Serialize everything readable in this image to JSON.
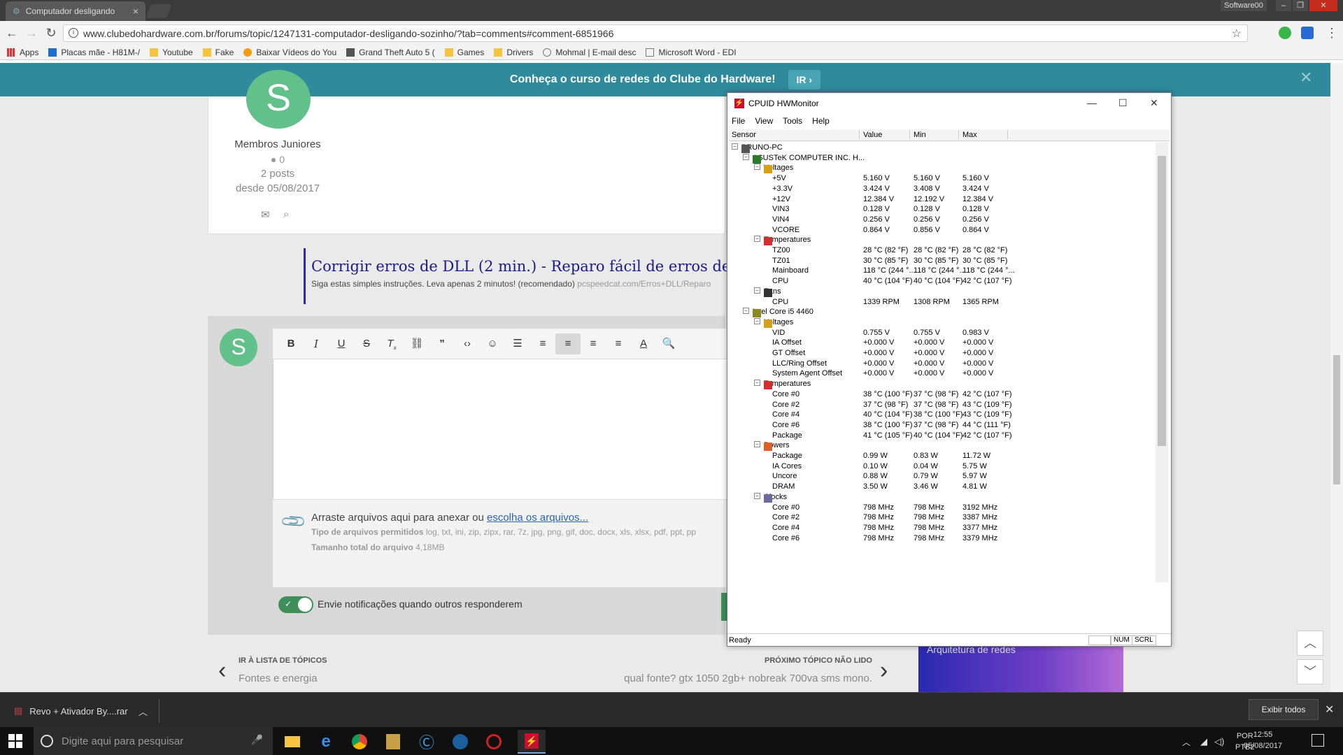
{
  "browser": {
    "tab_title": "Computador desligando",
    "profile": "Software00",
    "url": "www.clubedohardware.com.br/forums/topic/1247131-computador-desligando-sozinho/?tab=comments#comment-6851966",
    "bookmarks": [
      "Apps",
      "Placas mãe - H81M-/",
      "Youtube",
      "Fake",
      "Baixar Vídeos do You",
      "Grand Theft Auto 5 (",
      "Games",
      "Drivers",
      "Mohmal | E-mail desc",
      "Microsoft Word - EDI"
    ]
  },
  "banner": {
    "text": "Conheça o curso de redes do Clube do Hardware!",
    "button": "IR ›"
  },
  "post": {
    "avatar_letter": "S",
    "rank": "Membros Juniores",
    "reputation": "0",
    "posts": "2 posts",
    "since": "desde 05/08/2017"
  },
  "ad": {
    "title": "Corrigir erros de DLL (2 min.) - Reparo fácil de erros de DLL",
    "subtitle": "Siga estas simples instruções. Leva apenas 2 minutos! (recomendado)",
    "url": "pcspeedcat.com/Erros+DLL/Reparo"
  },
  "reply": {
    "avatar_letter": "S",
    "attach_text": "Arraste arquivos aqui para anexar ou",
    "attach_link": "escolha os arquivos...",
    "types_label": "Tipo de arquivos permitidos",
    "types": "log, txt, ini, zip, zipx, rar, 7z, jpg, png, gif, doc, docx, xls, xlsx, pdf, ppt, pp",
    "size_label": "Tamanho total do arquivo",
    "size": "4,18MB",
    "notify": "Envie notificações quando outros responderem"
  },
  "nav": {
    "back_label": "IR À LISTA DE TÓPICOS",
    "back_value": "Fontes e energia",
    "next_label": "PRÓXIMO TÓPICO NÃO LIDO",
    "next_value": "qual fonte? gtx 1050 2gb+ nobreak 700va sms mono.",
    "ad_caption": "Arquitetura de redes"
  },
  "hwmonitor": {
    "title": "CPUID HWMonitor",
    "menu": [
      "File",
      "View",
      "Tools",
      "Help"
    ],
    "columns": [
      "Sensor",
      "Value",
      "Min",
      "Max"
    ],
    "status": "Ready",
    "status_num": "NUM",
    "status_scrl": "SCRL",
    "rows": [
      {
        "level": 0,
        "icon": "pc",
        "name": "BRUNO-PC",
        "toggle": "-"
      },
      {
        "level": 1,
        "icon": "board",
        "name": "ASUSTeK COMPUTER INC. H...",
        "toggle": "-"
      },
      {
        "level": 2,
        "icon": "volt",
        "name": "Voltages",
        "toggle": "-"
      },
      {
        "level": 3,
        "name": "+5V",
        "value": "5.160 V",
        "min": "5.160 V",
        "max": "5.160 V"
      },
      {
        "level": 3,
        "name": "+3.3V",
        "value": "3.424 V",
        "min": "3.408 V",
        "max": "3.424 V"
      },
      {
        "level": 3,
        "name": "+12V",
        "value": "12.384 V",
        "min": "12.192 V",
        "max": "12.384 V"
      },
      {
        "level": 3,
        "name": "VIN3",
        "value": "0.128 V",
        "min": "0.128 V",
        "max": "0.128 V"
      },
      {
        "level": 3,
        "name": "VIN4",
        "value": "0.256 V",
        "min": "0.256 V",
        "max": "0.256 V"
      },
      {
        "level": 3,
        "name": "VCORE",
        "value": "0.864 V",
        "min": "0.856 V",
        "max": "0.864 V"
      },
      {
        "level": 2,
        "icon": "temp",
        "name": "Temperatures",
        "toggle": "-"
      },
      {
        "level": 3,
        "name": "TZ00",
        "value": "28 °C  (82 °F)",
        "min": "28 °C  (82 °F)",
        "max": "28 °C  (82 °F)"
      },
      {
        "level": 3,
        "name": "TZ01",
        "value": "30 °C  (85 °F)",
        "min": "30 °C  (85 °F)",
        "max": "30 °C  (85 °F)"
      },
      {
        "level": 3,
        "name": "Mainboard",
        "value": "118 °C  (244 °...",
        "min": "118 °C  (244 °...",
        "max": "118 °C  (244 °..."
      },
      {
        "level": 3,
        "name": "CPU",
        "value": "40 °C  (104 °F)",
        "min": "40 °C  (104 °F)",
        "max": "42 °C  (107 °F)"
      },
      {
        "level": 2,
        "icon": "fan",
        "name": "Fans",
        "toggle": "-"
      },
      {
        "level": 3,
        "name": "CPU",
        "value": "1339 RPM",
        "min": "1308 RPM",
        "max": "1365 RPM"
      },
      {
        "level": 1,
        "icon": "cpu",
        "name": "Intel Core i5 4460",
        "toggle": "-"
      },
      {
        "level": 2,
        "icon": "volt",
        "name": "Voltages",
        "toggle": "-"
      },
      {
        "level": 3,
        "name": "VID",
        "value": "0.755 V",
        "min": "0.755 V",
        "max": "0.983 V"
      },
      {
        "level": 3,
        "name": "IA Offset",
        "value": "+0.000 V",
        "min": "+0.000 V",
        "max": "+0.000 V"
      },
      {
        "level": 3,
        "name": "GT Offset",
        "value": "+0.000 V",
        "min": "+0.000 V",
        "max": "+0.000 V"
      },
      {
        "level": 3,
        "name": "LLC/Ring Offset",
        "value": "+0.000 V",
        "min": "+0.000 V",
        "max": "+0.000 V"
      },
      {
        "level": 3,
        "name": "System Agent Offset",
        "value": "+0.000 V",
        "min": "+0.000 V",
        "max": "+0.000 V"
      },
      {
        "level": 2,
        "icon": "temp",
        "name": "Temperatures",
        "toggle": "-"
      },
      {
        "level": 3,
        "name": "Core #0",
        "value": "38 °C  (100 °F)",
        "min": "37 °C  (98 °F)",
        "max": "42 °C  (107 °F)"
      },
      {
        "level": 3,
        "name": "Core #2",
        "value": "37 °C  (98 °F)",
        "min": "37 °C  (98 °F)",
        "max": "43 °C  (109 °F)"
      },
      {
        "level": 3,
        "name": "Core #4",
        "value": "40 °C  (104 °F)",
        "min": "38 °C  (100 °F)",
        "max": "43 °C  (109 °F)"
      },
      {
        "level": 3,
        "name": "Core #6",
        "value": "38 °C  (100 °F)",
        "min": "37 °C  (98 °F)",
        "max": "44 °C  (111 °F)"
      },
      {
        "level": 3,
        "name": "Package",
        "value": "41 °C  (105 °F)",
        "min": "40 °C  (104 °F)",
        "max": "42 °C  (107 °F)"
      },
      {
        "level": 2,
        "icon": "power",
        "name": "Powers",
        "toggle": "-"
      },
      {
        "level": 3,
        "name": "Package",
        "value": "0.99 W",
        "min": "0.83 W",
        "max": "11.72 W"
      },
      {
        "level": 3,
        "name": "IA Cores",
        "value": "0.10 W",
        "min": "0.04 W",
        "max": "5.75 W"
      },
      {
        "level": 3,
        "name": "Uncore",
        "value": "0.88 W",
        "min": "0.79 W",
        "max": "5.97 W"
      },
      {
        "level": 3,
        "name": "DRAM",
        "value": "3.50 W",
        "min": "3.46 W",
        "max": "4.81 W"
      },
      {
        "level": 2,
        "icon": "clock",
        "name": "Clocks",
        "toggle": "-"
      },
      {
        "level": 3,
        "name": "Core #0",
        "value": "798 MHz",
        "min": "798 MHz",
        "max": "3192 MHz"
      },
      {
        "level": 3,
        "name": "Core #2",
        "value": "798 MHz",
        "min": "798 MHz",
        "max": "3387 MHz"
      },
      {
        "level": 3,
        "name": "Core #4",
        "value": "798 MHz",
        "min": "798 MHz",
        "max": "3377 MHz"
      },
      {
        "level": 3,
        "name": "Core #6",
        "value": "798 MHz",
        "min": "798 MHz",
        "max": "3379 MHz"
      }
    ]
  },
  "downloads": {
    "file": "Revo + Ativador By....rar",
    "show_all": "Exibir todos"
  },
  "taskbar": {
    "search_placeholder": "Digite aqui para pesquisar",
    "lang": "POR",
    "layout": "PTB2",
    "time": "12:55",
    "date": "05/08/2017"
  }
}
